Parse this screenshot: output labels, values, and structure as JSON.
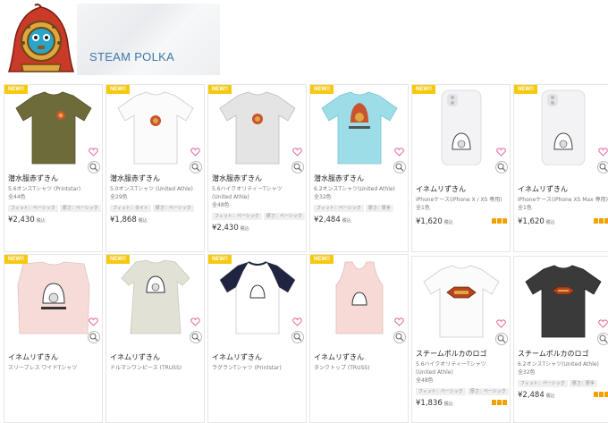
{
  "shop": {
    "name": "STEAM POLKA"
  },
  "colors": {
    "new_badge": "#f6c90e",
    "shop_name": "#3b78a8",
    "heart": "#e86aa0",
    "rank": "#f2a100"
  },
  "icons": {
    "favorite": "heart-icon",
    "zoom": "zoom-icon",
    "rank": "crown-icon"
  },
  "products": [
    {
      "new": "NEW!!",
      "title": "潜水服赤ずきん",
      "desc": "5.6オンスTシャツ (Printstar)",
      "count": "全44色",
      "tags": [
        "フィット：ベーシック",
        "厚さ：ベーシック"
      ],
      "price": "¥2,430",
      "tax": "税込"
    },
    {
      "new": "NEW!!",
      "title": "潜水服赤ずきん",
      "desc": "5.0オンスTシャツ (United Athle)",
      "count": "全29色",
      "tags": [
        "フィット：タイト",
        "厚さ：ベーシック"
      ],
      "price": "¥1,868",
      "tax": "税込"
    },
    {
      "new": "NEW!!",
      "title": "潜水服赤ずきん",
      "desc": "5.6ハイクオリティーTシャツ (United Athle)",
      "count": "全48色",
      "tags": [
        "フィット：ベーシック",
        "厚さ：ベーシック"
      ],
      "price": "¥2,430",
      "tax": "税込"
    },
    {
      "new": "NEW!!",
      "title": "潜水服赤ずきん",
      "desc": "6.2オンスTシャツ(United Athle)",
      "count": "全32色",
      "tags": [
        "フィット：ベーシック",
        "厚さ：厚手"
      ],
      "price": "¥2,484",
      "tax": "税込"
    },
    {
      "new": "NEW!!",
      "title": "イネムリずきん",
      "desc": "iPhoneケース(iPhone X / XS 専用)",
      "count": "全1色",
      "tags": [],
      "price": "¥1,620",
      "tax": "税込"
    },
    {
      "new": "NEW!!",
      "title": "イネムリずきん",
      "desc": "iPhoneケース(iPhone XS Max 専用)",
      "count": "全1色",
      "tags": [],
      "price": "¥1,620",
      "tax": "税込"
    },
    {
      "new": "NEW!!",
      "title": "イネムリずきん",
      "desc": "スリーブレス ワイドTシャツ",
      "count": "",
      "tags": [],
      "price": "",
      "tax": ""
    },
    {
      "new": "NEW!!",
      "title": "イネムリずきん",
      "desc": "ドルマンワンピース (TRUSS)",
      "count": "",
      "tags": [],
      "price": "",
      "tax": ""
    },
    {
      "new": "NEW!!",
      "title": "イネムリずきん",
      "desc": "ラグランTシャツ (Printstar)",
      "count": "",
      "tags": [],
      "price": "",
      "tax": ""
    },
    {
      "new": "NEW!!",
      "title": "イネムリずきん",
      "desc": "タンクトップ (TRUSS)",
      "count": "",
      "tags": [],
      "price": "",
      "tax": ""
    },
    {
      "new": "",
      "title": "スチームポルカのロゴ",
      "desc": "5.6ハイクオリティーTシャツ (United Athle)",
      "count": "全48色",
      "tags": [
        "フィット：ベーシック",
        "厚さ：ベーシック"
      ],
      "price": "¥1,836",
      "tax": "税込"
    },
    {
      "new": "",
      "title": "スチームポルカのロゴ",
      "desc": "6.2オンスTシャツ(United Athle)",
      "count": "全32色",
      "tags": [
        "フィット：ベーシック",
        "厚さ：厚手"
      ],
      "price": "¥2,484",
      "tax": "税込"
    }
  ]
}
